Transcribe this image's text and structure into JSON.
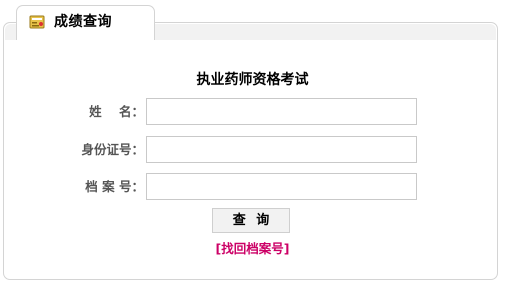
{
  "tab": {
    "icon": "score-report-icon",
    "title": "成绩查询"
  },
  "form": {
    "exam_title": "执业药师资格考试",
    "fields": [
      {
        "label": "姓    名：",
        "value": "",
        "placeholder": ""
      },
      {
        "label": "身份证号：",
        "value": "",
        "placeholder": ""
      },
      {
        "label": "档 案 号：",
        "value": "",
        "placeholder": ""
      }
    ],
    "submit_label": "查 询",
    "find_link": "[找回档案号]"
  },
  "colors": {
    "link": "#cc0066",
    "label": "#555555",
    "border": "#d4d4d4",
    "icon_body": "#e8c34a"
  }
}
